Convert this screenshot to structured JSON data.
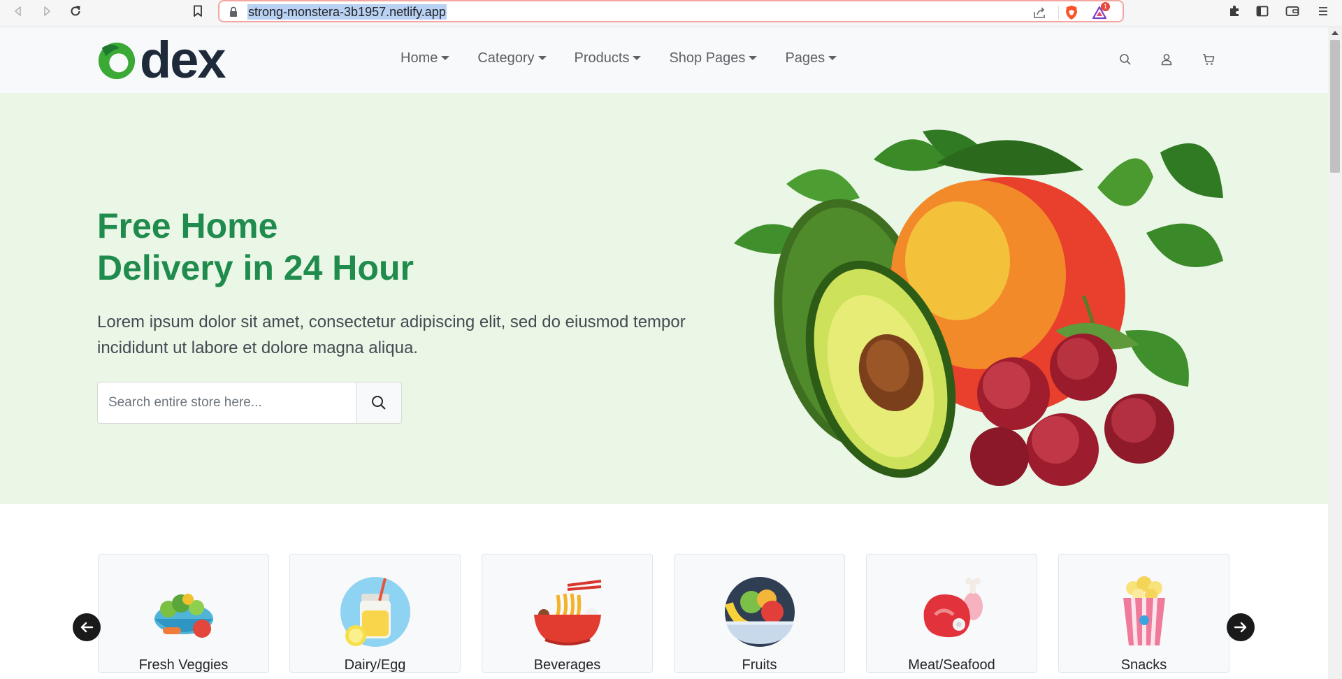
{
  "browser": {
    "url": "strong-monstera-3b1957.netlify.app",
    "back_icon": "back-arrow-icon",
    "forward_icon": "forward-arrow-icon",
    "reload_icon": "reload-icon",
    "bookmark_icon": "bookmark-icon",
    "lock_icon": "lock-icon",
    "share_icon": "share-icon",
    "brave_icon": "brave-shield-icon",
    "rewards_icon": "brave-rewards-icon",
    "rewards_badge": "1",
    "extensions_icon": "puzzle-icon",
    "sidebar_icon": "sidebar-icon",
    "wallet_icon": "wallet-icon",
    "menu_icon": "menu-icon"
  },
  "header": {
    "logo_text": "dex",
    "nav": [
      {
        "label": "Home"
      },
      {
        "label": "Category"
      },
      {
        "label": "Products"
      },
      {
        "label": "Shop Pages"
      },
      {
        "label": "Pages"
      }
    ],
    "icons": [
      "search-icon",
      "user-icon",
      "cart-icon"
    ]
  },
  "hero": {
    "title_line1": "Free Home",
    "title_line2": "Delivery in 24 Hour",
    "description": "Lorem ipsum dolor sit amet, consectetur adipiscing elit, sed do eiusmod tempor incididunt ut labore et dolore magna aliqua.",
    "search_placeholder": "Search entire store here..."
  },
  "categories": [
    {
      "label": "Fresh Veggies",
      "icon": "salad-bowl-icon"
    },
    {
      "label": "Dairy/Egg",
      "icon": "juice-jar-icon"
    },
    {
      "label": "Beverages",
      "icon": "noodle-bowl-icon"
    },
    {
      "label": "Fruits",
      "icon": "fruit-bowl-icon"
    },
    {
      "label": "Meat/Seafood",
      "icon": "meat-icon"
    },
    {
      "label": "Snacks",
      "icon": "popcorn-icon"
    }
  ],
  "colors": {
    "brand_green": "#1f8b4c",
    "hero_bg": "#eaf6e6",
    "logo_green": "#3aa935",
    "logo_dark": "#1e2a3a"
  }
}
